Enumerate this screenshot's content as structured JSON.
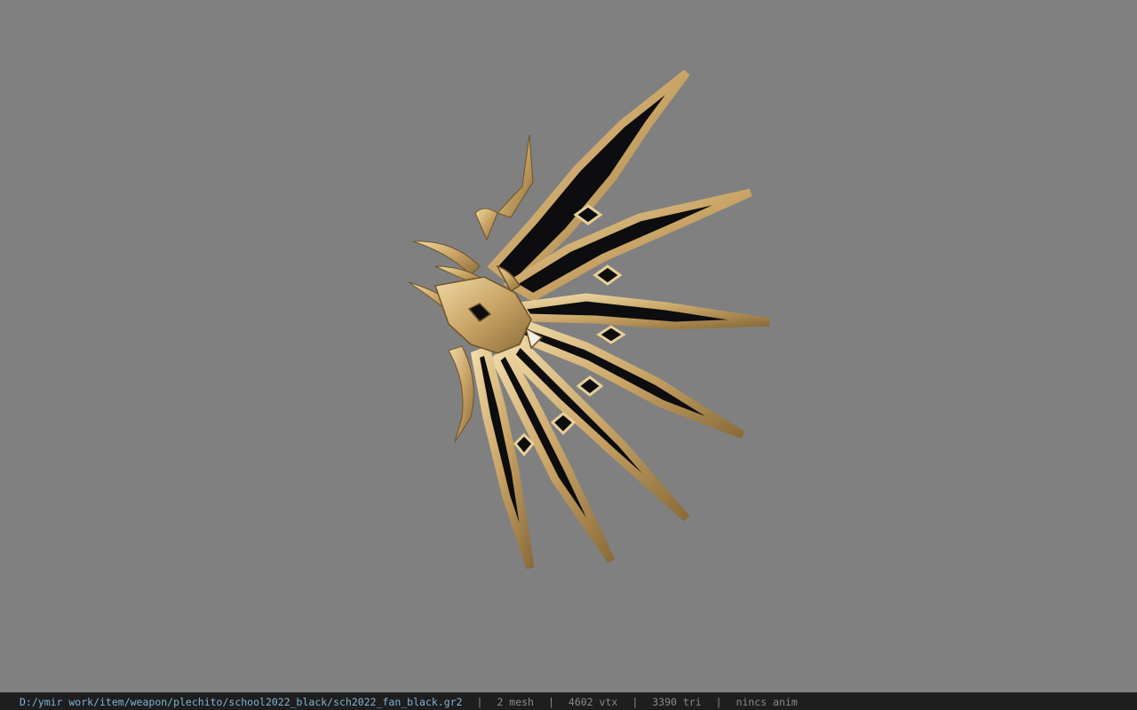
{
  "viewport": {
    "background": "#808080",
    "model_colors": {
      "gold": "#c9a466",
      "gold_light": "#e7cf98",
      "gold_dark": "#8a6c3a",
      "black": "#0d0d0f"
    }
  },
  "status_bar": {
    "file_path": "D:/ymir work/item/weapon/plechito/school2022_black/sch2022_fan_black.gr2",
    "separator": "|",
    "mesh_count": "2 mesh",
    "vertex_count": "4602 vtx",
    "triangle_count": "3390 tri",
    "anim_status": "nincs anim",
    "path_color": "#7fb3d5",
    "text_color": "#8a8a8a"
  }
}
